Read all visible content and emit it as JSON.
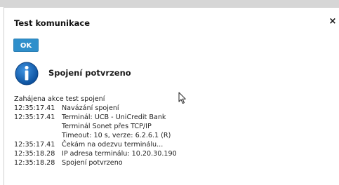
{
  "dialog": {
    "title": "Test komunikace",
    "close_label": "×",
    "ok_label": "OK",
    "status_heading": "Spojení potvrzeno",
    "icon": "info-icon"
  },
  "log": [
    {
      "time": "",
      "text": "Zahájena akce test spojení"
    },
    {
      "time": "12:35:17.41",
      "text": "Navázání spojení"
    },
    {
      "time": "12:35:17.41",
      "text": "Terminál: UCB - UniCredit Bank"
    },
    {
      "time": "",
      "text": "Terminál Sonet přes TCP/IP"
    },
    {
      "time": "",
      "text": "Timeout: 10 s,  verze: 6.2.6.1 (R)"
    },
    {
      "time": "12:35:17.41",
      "text": "Čekám na odezvu terminálu..."
    },
    {
      "time": "12:35:18.28",
      "text": "IP adresa terminálu: 10.20.30.190"
    },
    {
      "time": "12:35:18.28",
      "text": "Spojení potvrzeno"
    }
  ],
  "colors": {
    "button": "#2f8fcb",
    "info_icon": "#1565b0"
  }
}
